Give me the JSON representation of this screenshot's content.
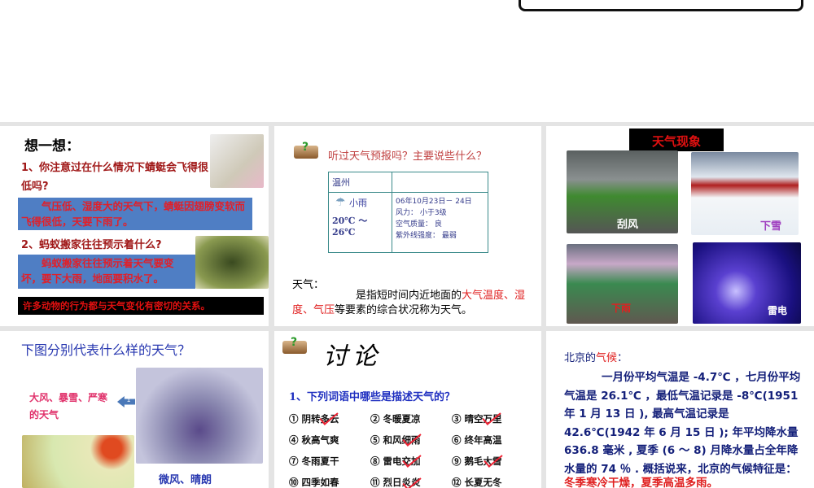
{
  "slide1": {
    "title": "想一想：",
    "q1": "1、你注意过在什么情况下蜻蜓会飞得很低吗?",
    "a1": "气压低、湿度大的天气下，蜻蜓因翅膀变软而飞得很低，天要下雨了。",
    "q2": "2、蚂蚁搬家往往预示着什么?",
    "a2": "蚂蚁搬家往往预示着天气要变坏，要下大雨，地面要积水了。",
    "banner": "许多动物的行为都与天气变化有密切的关系。"
  },
  "slide2": {
    "question": "听过天气预报吗？主要说些什么？",
    "city": "温州",
    "weather": "小雨",
    "temp": "20℃ ～26℃",
    "date": "06年10月23日－ 24日",
    "wind": "风力： 小于3级",
    "air": "空气质量： 良",
    "uv": "紫外线强度： 最弱",
    "def_label": "天气：",
    "def_a": "是指短时间内近地面的",
    "def_red1": "大气温度、湿度、气压",
    "def_b": "等要素的综合状况称为天气。"
  },
  "slide3": {
    "title": "天气现象",
    "captions": [
      "刮风",
      "下雪",
      "下雨",
      "雷电"
    ]
  },
  "slide4": {
    "title": "下图分别代表什么样的天气？",
    "answer1": "大风、暴雪、严寒的天气",
    "arrow_num": "1",
    "answer2": "微风、晴朗"
  },
  "slide5": {
    "title": "讨论",
    "question": "1、下列词语中哪些是描述天气的？",
    "options": [
      "① 阴转多云",
      "② 冬暖夏凉",
      "③ 晴空万里",
      "④ 秋高气爽",
      "⑤ 和风细雨",
      "⑥ 终年高温",
      "⑦ 冬雨夏干",
      "⑧ 雷电交加",
      "⑨ 鹅毛大雪",
      "⑩ 四季如春",
      "⑪ 烈日炎炎",
      "⑫ 长夏无冬"
    ]
  },
  "slide6": {
    "heading": "北京的",
    "heading_red": "气候",
    "heading_colon": "：",
    "body": "一月份平均气温是 -4.7℃ ，七月份平均气温是 26.1℃ ，最低气温记录是 -8℃(1951 年 1 月 13 日 ), 最高气温记录是 42.6℃(1942 年 6 月 15 日 ); 年平均降水量 636.8 毫米 , 夏季 (6 ～ 8) 月降水量占全年降水量的 74 ％ . 概括说来，北京的气候特征是：",
    "conclusion": "冬季寒冷干燥，夏季高温多雨。"
  }
}
